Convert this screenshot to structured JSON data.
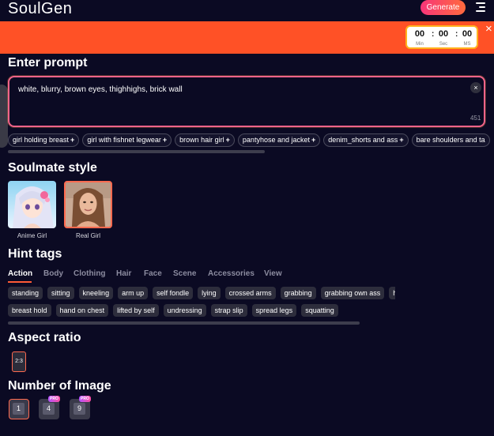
{
  "header": {
    "logo": "SoulGen",
    "generate_label": "Generate"
  },
  "promo": {
    "timer": {
      "min_value": "00",
      "min_label": "Min",
      "sec_value": "00",
      "sec_label": "Sec",
      "ms_value": "00",
      "ms_label": "MS"
    },
    "close_glyph": "×"
  },
  "prompt": {
    "heading": "Enter prompt",
    "value": "white, blurry, brown eyes, thighhighs, brick wall",
    "char_count": "451",
    "clear_glyph": "×"
  },
  "suggestions": [
    "girl holding breast",
    "girl with fishnet legwear",
    "brown hair girl",
    "pantyhose and jacket",
    "denim_shorts and ass",
    "bare shoulders and ta"
  ],
  "soulmate": {
    "heading": "Soulmate style",
    "options": [
      {
        "label": "Anime Girl",
        "selected": false
      },
      {
        "label": "Real Girl",
        "selected": true
      }
    ]
  },
  "hints": {
    "heading": "Hint tags",
    "tabs": [
      "Action",
      "Body",
      "Clothing",
      "Hair",
      "Face",
      "Scene",
      "Accessories",
      "View"
    ],
    "active_tab": "Action",
    "row1": [
      "standing",
      "sitting",
      "kneeling",
      "arm up",
      "self fondle",
      "lying",
      "crossed arms",
      "grabbing",
      "grabbing own ass",
      "ha"
    ],
    "row2": [
      "breast hold",
      "hand on chest",
      "lifted by self",
      "undressing",
      "strap slip",
      "spread legs",
      "squatting"
    ]
  },
  "aspect": {
    "heading": "Aspect ratio",
    "value": "2:3"
  },
  "images": {
    "heading": "Number of Image",
    "options": [
      {
        "value": "1",
        "pro": false,
        "selected": true
      },
      {
        "value": "4",
        "pro": true,
        "selected": false
      },
      {
        "value": "9",
        "pro": true,
        "selected": false
      }
    ],
    "pro_label": "PRO"
  },
  "colors": {
    "background": "#0b0a23",
    "promo_bar": "#ff5126",
    "accent": "#ff5a36",
    "tag_bg": "#2d2d3c"
  }
}
